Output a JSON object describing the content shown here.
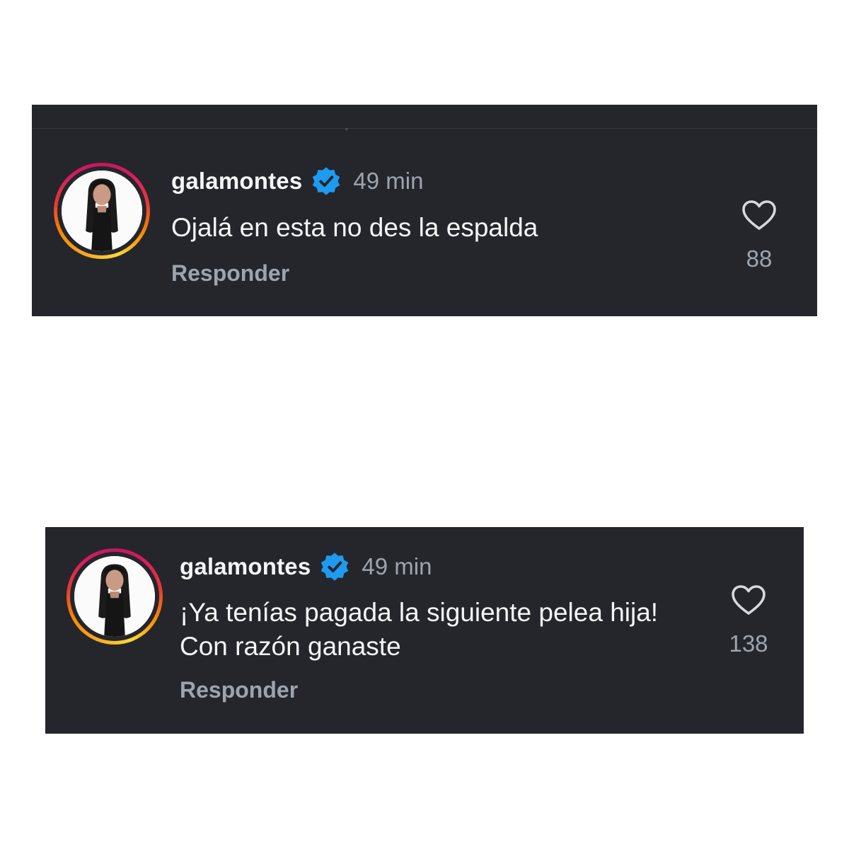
{
  "colors": {
    "page_background": "#ffffff",
    "card_background": "#24262c",
    "primary_text": "#f5f5f5",
    "secondary_text": "#9ea4ae",
    "verified_badge": "#1d9bf0"
  },
  "comments": [
    {
      "username": "galamontes",
      "verified": true,
      "time": "49 min",
      "text": "Ojalá en esta no des la espalda",
      "reply_label": "Responder",
      "like_count": "88",
      "avatar_icon": "profile-avatar",
      "like_icon": "heart-outline-icon"
    },
    {
      "username": "galamontes",
      "verified": true,
      "time": "49 min",
      "text": "¡Ya tenías pagada la siguiente pelea hija! Con razón ganaste",
      "reply_label": "Responder",
      "like_count": "138",
      "avatar_icon": "profile-avatar",
      "like_icon": "heart-outline-icon"
    }
  ]
}
